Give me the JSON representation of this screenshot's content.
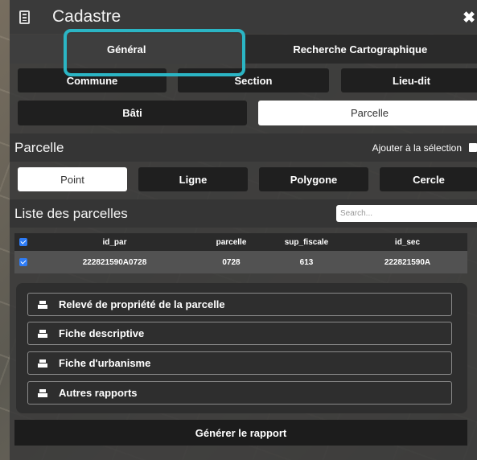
{
  "window": {
    "title": "Cadastre",
    "close_glyph": "✖"
  },
  "tabs": [
    {
      "label": "Général",
      "active": true
    },
    {
      "label": "Recherche Cartographique",
      "active": false
    }
  ],
  "search_modes_row1": [
    "Commune",
    "Section",
    "Lieu-dit"
  ],
  "search_modes_row2": [
    {
      "label": "Bâti",
      "selected": false
    },
    {
      "label": "Parcelle",
      "selected": true
    }
  ],
  "parcelle_section": {
    "title": "Parcelle",
    "add_to_selection_label": "Ajouter à la sélection"
  },
  "draw_tools": [
    {
      "label": "Point",
      "selected": true
    },
    {
      "label": "Ligne",
      "selected": false
    },
    {
      "label": "Polygone",
      "selected": false
    },
    {
      "label": "Cercle",
      "selected": false
    }
  ],
  "list": {
    "title": "Liste des parcelles",
    "search_placeholder": "Search...",
    "columns": [
      "id_par",
      "parcelle",
      "sup_fiscale",
      "id_sec"
    ],
    "rows": [
      {
        "checked": true,
        "id_par": "222821590A0728",
        "parcelle": "0728",
        "sup_fiscale": "613",
        "id_sec": "222821590A"
      }
    ]
  },
  "reports": [
    "Relevé de propriété de la parcelle",
    "Fiche descriptive",
    "Fiche d'urbanisme",
    "Autres rapports"
  ],
  "generate_label": "Générer le rapport",
  "colors": {
    "highlight": "#2bb5c4",
    "checkbox": "#2e7cf6",
    "panel": "#3a3a3a"
  }
}
